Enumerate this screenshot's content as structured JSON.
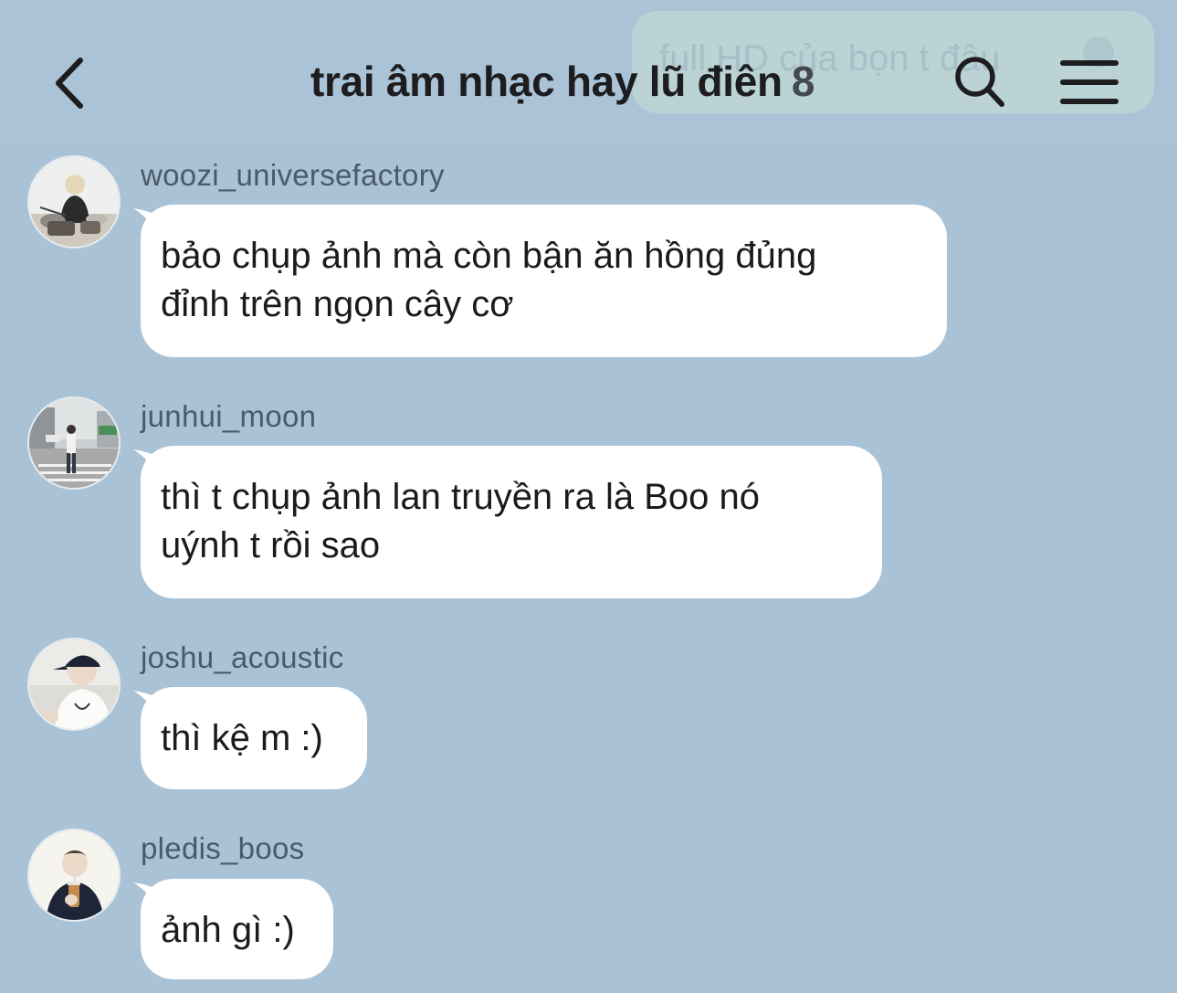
{
  "header": {
    "back_icon": "chevron-left-icon",
    "title": "trai âm nhạc hay lũ điên",
    "member_count": "8",
    "search_icon": "search-icon",
    "menu_icon": "hamburger-menu-icon",
    "background_message": "full HD của bọn t đâu"
  },
  "colors": {
    "background": "#aac2d6",
    "bubble": "#ffffff",
    "sender_text": "#4a5a67",
    "title_text": "#1d1d1f"
  },
  "messages": [
    {
      "sender": "woozi_universefactory",
      "text_line1": "bảo chụp ảnh mà còn bận ăn hồng đủng",
      "text_line2": "đỉnh trên ngọn cây cơ"
    },
    {
      "sender": "junhui_moon",
      "text_line1": "thì t chụp ảnh lan truyền ra là Boo nó",
      "text_line2": "uýnh t rồi sao"
    },
    {
      "sender": "joshu_acoustic",
      "text_line1": "thì kệ m :)"
    },
    {
      "sender": "pledis_boos",
      "text_line1": "ảnh gì :)"
    }
  ]
}
